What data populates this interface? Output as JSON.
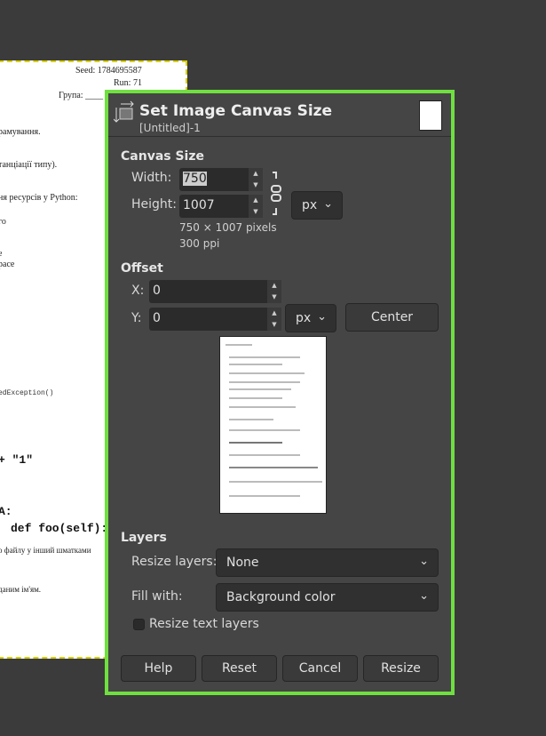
{
  "canvas_page": {
    "seed": "Seed: 1784695587",
    "run": "Run: 71",
    "group": "Група: ____",
    "lines": [
      "рамування.",
      "танціації типу).",
      "ня ресурсів у Python:",
      "го",
      "е",
      "pace",
      "edException()",
      "+ \"1\"",
      "A:",
      "def foo(self):",
      "о файлу у інший шматками",
      "даним ім'ям."
    ]
  },
  "dialog": {
    "title": "Set Image Canvas Size",
    "subtitle": "[Untitled]-1",
    "canvas_size": {
      "heading": "Canvas Size",
      "width_label": "Width:",
      "width_value": "750",
      "height_label": "Height:",
      "height_value": "1007",
      "unit": "px",
      "pixels_info": "750 × 1007 pixels",
      "ppi_info": "300 ppi"
    },
    "offset": {
      "heading": "Offset",
      "x_label": "X:",
      "x_value": "0",
      "y_label": "Y:",
      "y_value": "0",
      "unit": "px",
      "center_label": "Center"
    },
    "layers": {
      "heading": "Layers",
      "resize_layers_label": "Resize layers:",
      "resize_layers_value": "None",
      "fill_label": "Fill with:",
      "fill_value": "Background color",
      "resize_text_label": "Resize text layers",
      "resize_text_checked": false
    },
    "buttons": {
      "help": "Help",
      "reset": "Reset",
      "cancel": "Cancel",
      "resize": "Resize"
    }
  },
  "colors": {
    "accent_border": "#6fe040",
    "dialog_bg": "#454545",
    "selection_dash": "#d8d000"
  }
}
